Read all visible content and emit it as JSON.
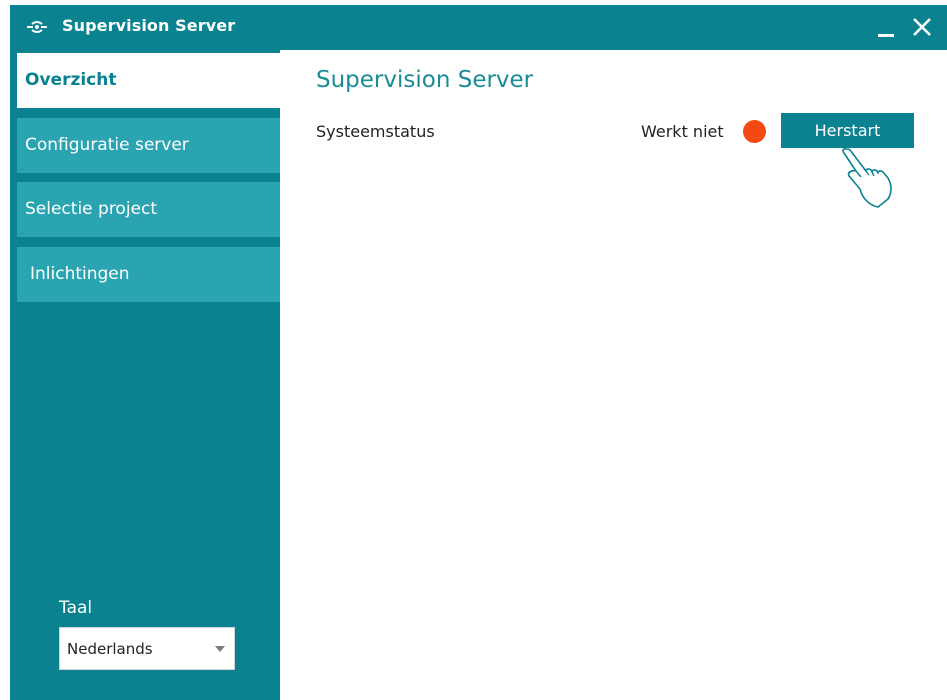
{
  "window": {
    "title": "Supervision Server",
    "app_icon": "supervision-logo-icon",
    "minimize_icon": "minimize-icon",
    "close_icon": "close-icon"
  },
  "sidebar": {
    "items": [
      {
        "label": "Overzicht",
        "active": true
      },
      {
        "label": "Configuratie server",
        "active": false
      },
      {
        "label": "Selectie project",
        "active": false
      },
      {
        "label": "Inlichtingen",
        "active": false
      }
    ],
    "language_label": "Taal",
    "language_value": "Nederlands"
  },
  "main": {
    "title": "Supervision Server",
    "status_label": "Systeemstatus",
    "status_text": "Werkt niet",
    "status_color": "#f24a12",
    "restart_label": "Herstart",
    "pointer_icon": "hand-pointer-icon"
  },
  "colors": {
    "primary": "#0a8290",
    "nav_item": "#2ba4b2",
    "title_text": "#1b8b97"
  }
}
